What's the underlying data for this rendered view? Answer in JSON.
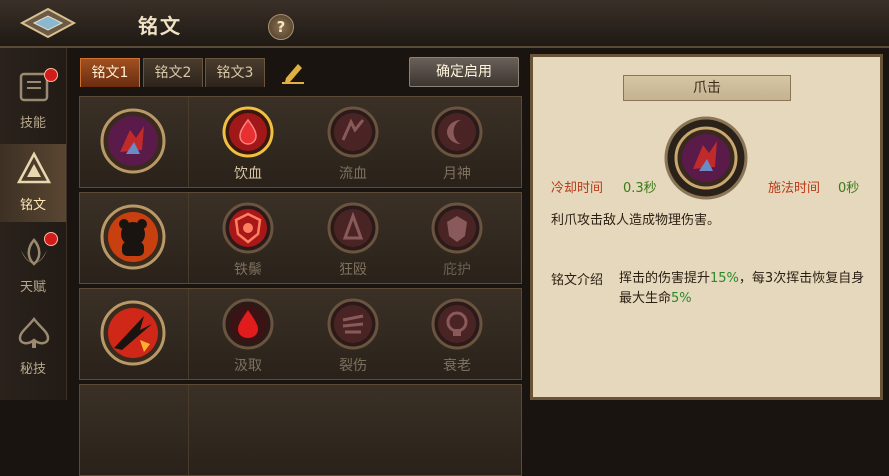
{
  "header": {
    "title": "铭文",
    "help_label": "?"
  },
  "sidebar": {
    "items": [
      {
        "label": "技能",
        "icon": "book-icon",
        "active": false,
        "badge": true
      },
      {
        "label": "铭文",
        "icon": "triangle-rune-icon",
        "active": true,
        "badge": false
      },
      {
        "label": "天赋",
        "icon": "lotus-icon",
        "active": false,
        "badge": true
      },
      {
        "label": "秘技",
        "icon": "spade-icon",
        "active": false,
        "badge": false
      }
    ]
  },
  "tabs": [
    {
      "label": "铭文1",
      "active": true
    },
    {
      "label": "铭文2",
      "active": false
    },
    {
      "label": "铭文3",
      "active": false
    }
  ],
  "toolbar": {
    "confirm_label": "确定启用"
  },
  "rows": [
    {
      "main_icon": "claw-strike-icon",
      "runes": [
        {
          "name": "饮血",
          "state": "selected"
        },
        {
          "name": "流血",
          "state": "normal"
        },
        {
          "name": "月神",
          "state": "normal"
        }
      ]
    },
    {
      "main_icon": "bear-icon",
      "runes": [
        {
          "name": "铁鬃",
          "state": "normal"
        },
        {
          "name": "狂殴",
          "state": "normal"
        },
        {
          "name": "庇护",
          "state": "dim"
        }
      ]
    },
    {
      "main_icon": "slash-icon",
      "runes": [
        {
          "name": "汲取",
          "state": "normal"
        },
        {
          "name": "裂伤",
          "state": "normal"
        },
        {
          "name": "衰老",
          "state": "normal"
        }
      ]
    }
  ],
  "detail": {
    "title": "爪击",
    "cooldown_label": "冷却时间",
    "cooldown_value": "0.3秒",
    "cast_label": "施法时间",
    "cast_value": "0秒",
    "description": "利爪攻击敌人造成物理伤害。",
    "intro_label": "铭文介绍",
    "intro_p1": "挥击的伤害提升",
    "intro_v1": "15%",
    "intro_p2": "，每3次挥击恢复自身最大生命",
    "intro_v2": "5%"
  },
  "colors": {
    "accent": "#d07030",
    "selected_ring": "#e8b030",
    "rune_red": "#c81e1e"
  }
}
